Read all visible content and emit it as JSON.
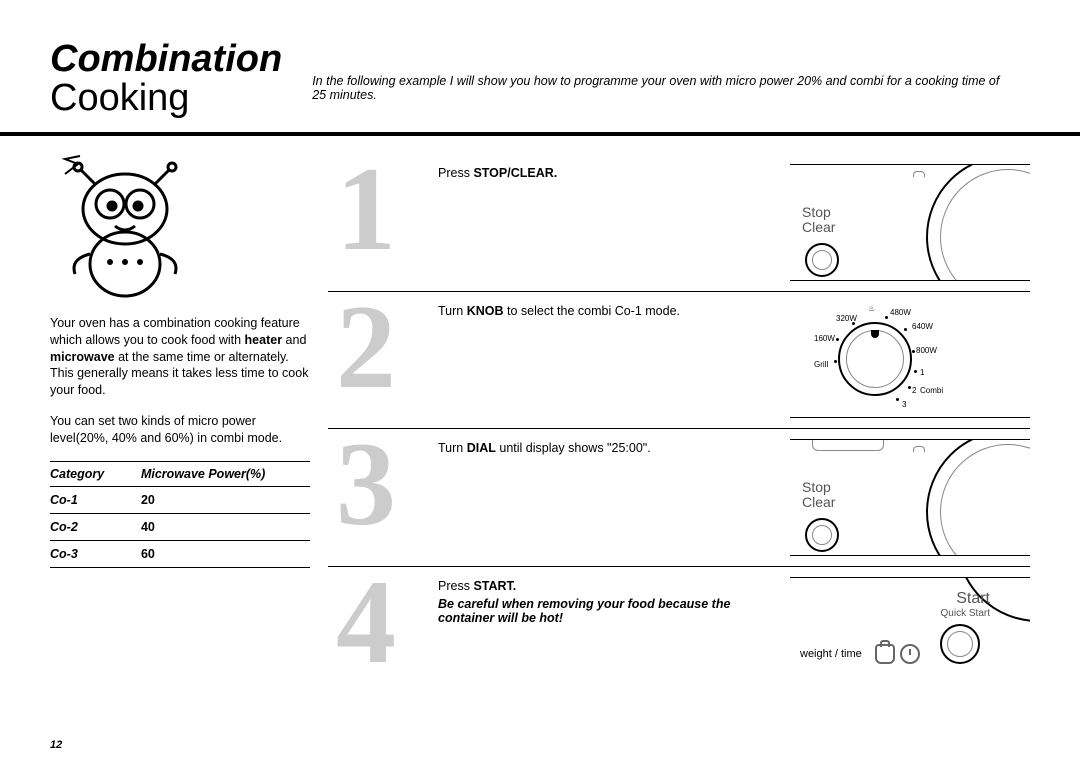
{
  "title": {
    "main": "Combination",
    "sub": "Cooking"
  },
  "intro": "In the following example I will show you how to programme your oven with micro power 20% and combi for a cooking time of 25 minutes.",
  "left": {
    "para1_a": "Your oven has a combination cooking feature which allows you to cook food with ",
    "para1_b1": "heater",
    "para1_c": " and ",
    "para1_b2": "microwave",
    "para1_d": " at the same time or alternately. This generally means it takes less time to cook your food.",
    "para2": "You can set two kinds of micro power level(20%, 40% and 60%) in combi mode."
  },
  "table": {
    "head_cat": "Category",
    "head_pow": "Microwave Power(%)",
    "rows": [
      {
        "cat": "Co-1",
        "pow": "20"
      },
      {
        "cat": "Co-2",
        "pow": "40"
      },
      {
        "cat": "Co-3",
        "pow": "60"
      }
    ]
  },
  "steps": {
    "s1": {
      "num": "1",
      "pre": "Press ",
      "b": "STOP/CLEAR.",
      "post": ""
    },
    "s2": {
      "num": "2",
      "pre": "Turn ",
      "b": "KNOB",
      "post": " to select the combi Co-1 mode."
    },
    "s3": {
      "num": "3",
      "pre": "Turn ",
      "b": "DIAL",
      "post": " until display shows \"25:00\"."
    },
    "s4": {
      "num": "4",
      "pre": "Press ",
      "b": "START.",
      "post": ""
    }
  },
  "warning": "Be careful when removing your food because the container will be hot!",
  "panel": {
    "stop_clear_1": "Stop",
    "stop_clear_2": "Clear",
    "start": "Start",
    "quick": "Quick Start",
    "weight_time": "weight / time",
    "knob": {
      "w480": "480W",
      "w320": "320W",
      "w640": "640W",
      "w160": "160W",
      "w800": "800W",
      "grill": "Grill",
      "p1": "1",
      "p2": "2",
      "p3": "3",
      "combi": "Combi",
      "heat": "♨"
    }
  },
  "page_num": "12"
}
